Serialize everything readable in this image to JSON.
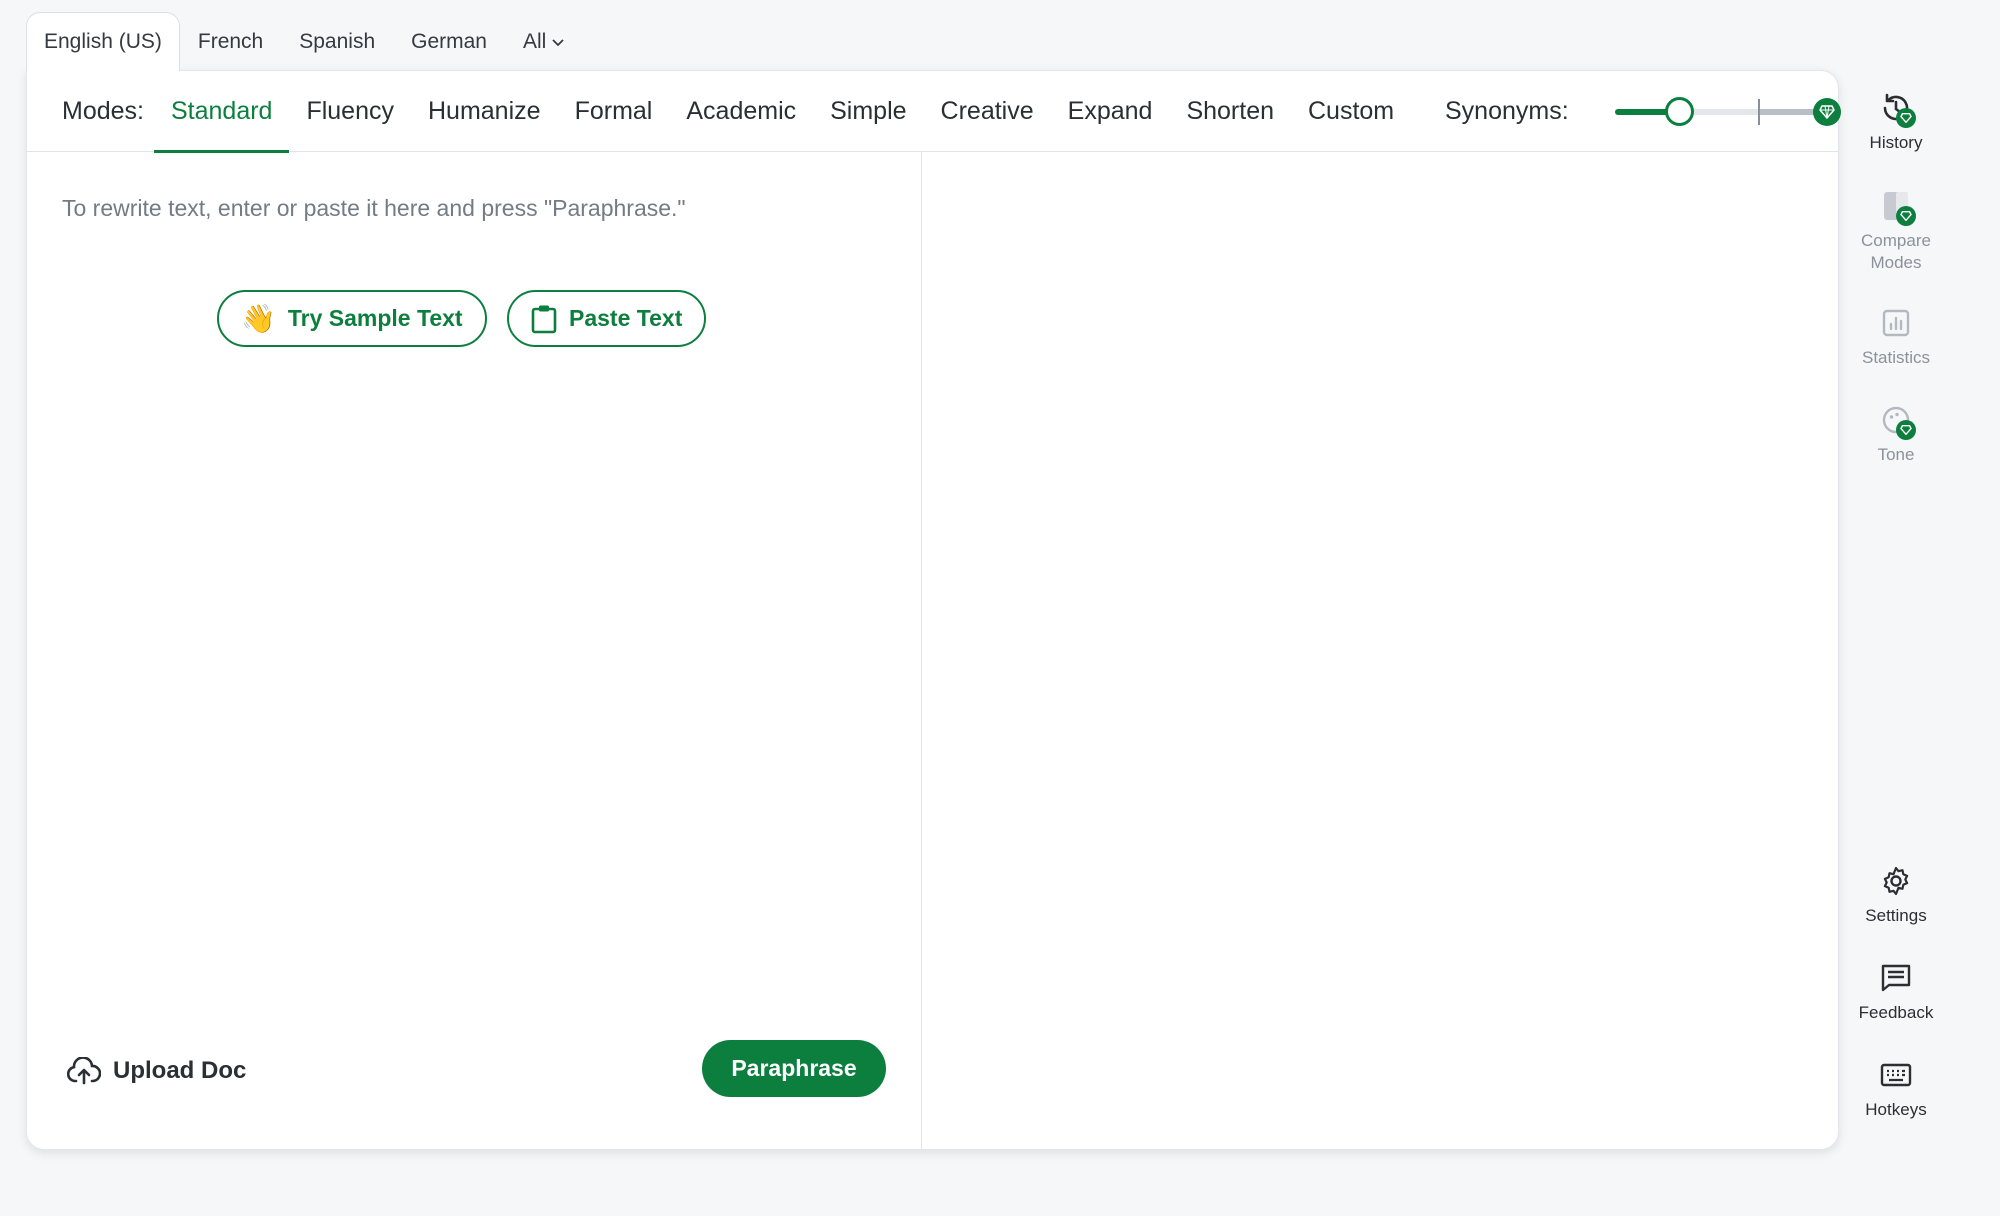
{
  "languages": {
    "tabs": [
      "English (US)",
      "French",
      "Spanish",
      "German"
    ],
    "all_label": "All",
    "active": "English (US)"
  },
  "modes": {
    "label": "Modes:",
    "items": [
      "Standard",
      "Fluency",
      "Humanize",
      "Formal",
      "Academic",
      "Simple",
      "Creative",
      "Expand",
      "Shorten",
      "Custom"
    ],
    "active": "Standard"
  },
  "synonyms": {
    "label": "Synonyms:",
    "level": 0.3
  },
  "editor": {
    "placeholder": "To rewrite text, enter or paste it here and press \"Paraphrase.\"",
    "sample_button": "Try Sample Text",
    "paste_button": "Paste Text",
    "upload_label": "Upload Doc",
    "paraphrase_button": "Paraphrase"
  },
  "sidebar": {
    "top": [
      {
        "label": "History",
        "icon": "history-icon",
        "premium": true,
        "disabled": false
      },
      {
        "label": "Compare\nModes",
        "icon": "compare-modes-icon",
        "premium": true,
        "disabled": true
      },
      {
        "label": "Statistics",
        "icon": "statistics-icon",
        "premium": false,
        "disabled": true
      },
      {
        "label": "Tone",
        "icon": "tone-icon",
        "premium": true,
        "disabled": true
      }
    ],
    "bottom": [
      {
        "label": "Settings",
        "icon": "gear-icon"
      },
      {
        "label": "Feedback",
        "icon": "feedback-icon"
      },
      {
        "label": "Hotkeys",
        "icon": "keyboard-icon"
      }
    ]
  },
  "colors": {
    "accent": "#0c7f3f",
    "background": "#f6f7f9"
  }
}
